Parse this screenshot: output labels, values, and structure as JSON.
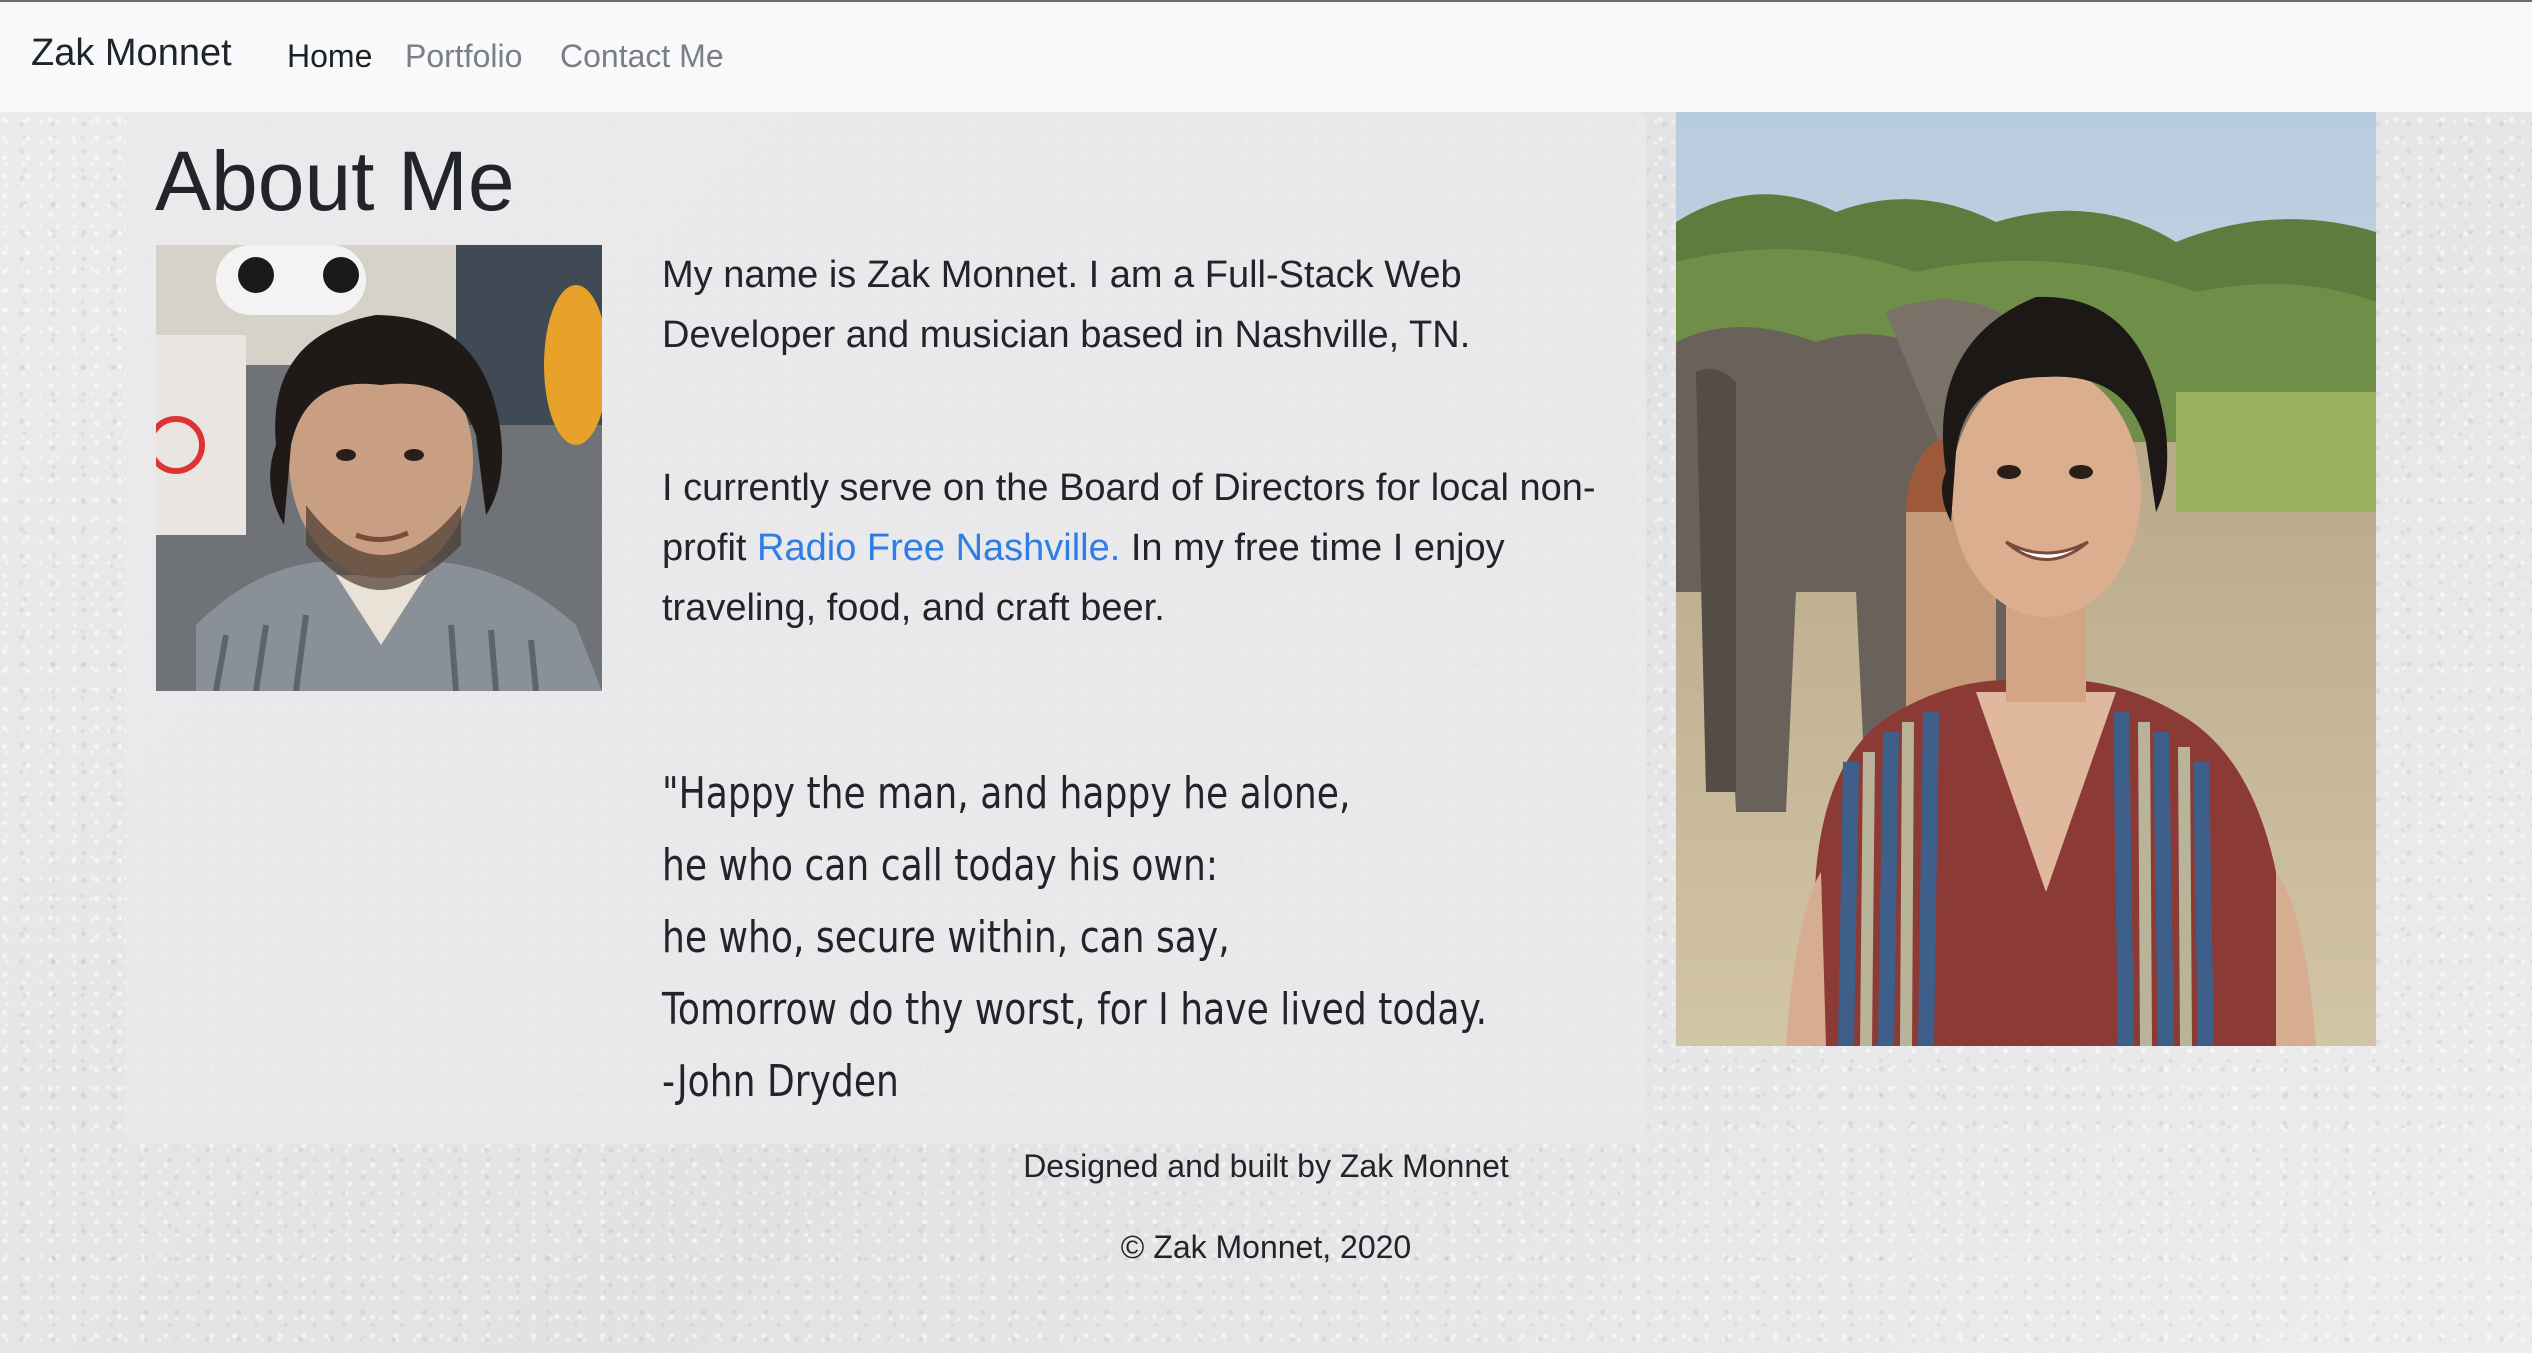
{
  "navbar": {
    "brand": "Zak Monnet",
    "links": [
      {
        "label": "Home"
      },
      {
        "label": "Portfolio"
      },
      {
        "label": "Contact Me"
      }
    ]
  },
  "main": {
    "title": "About Me",
    "bio_paragraph_1": "My name is Zak Monnet. I am a Full-Stack Web Developer and musician based in Nashville, TN.",
    "bio_paragraph_2": {
      "before_link": "I currently serve on the Board of Directors for local non-profit ",
      "link_text": "Radio Free Nashville.",
      "after_link": " In my free time I enjoy traveling, food, and craft beer."
    },
    "quote_lines": [
      "\"Happy the man, and happy he alone,",
      "he who can call today his own:",
      "he who, secure within, can say,",
      "Tomorrow do thy worst, for I have lived today.",
      "-John Dryden"
    ]
  },
  "footer": {
    "credit": "Designed and built by Zak Monnet",
    "copyright": "© Zak Monnet, 2020"
  },
  "colors": {
    "link": "#2f7de6",
    "text": "#212529",
    "navbar_bg": "#f8f9fa",
    "nav_inactive": "#7b7f83"
  }
}
